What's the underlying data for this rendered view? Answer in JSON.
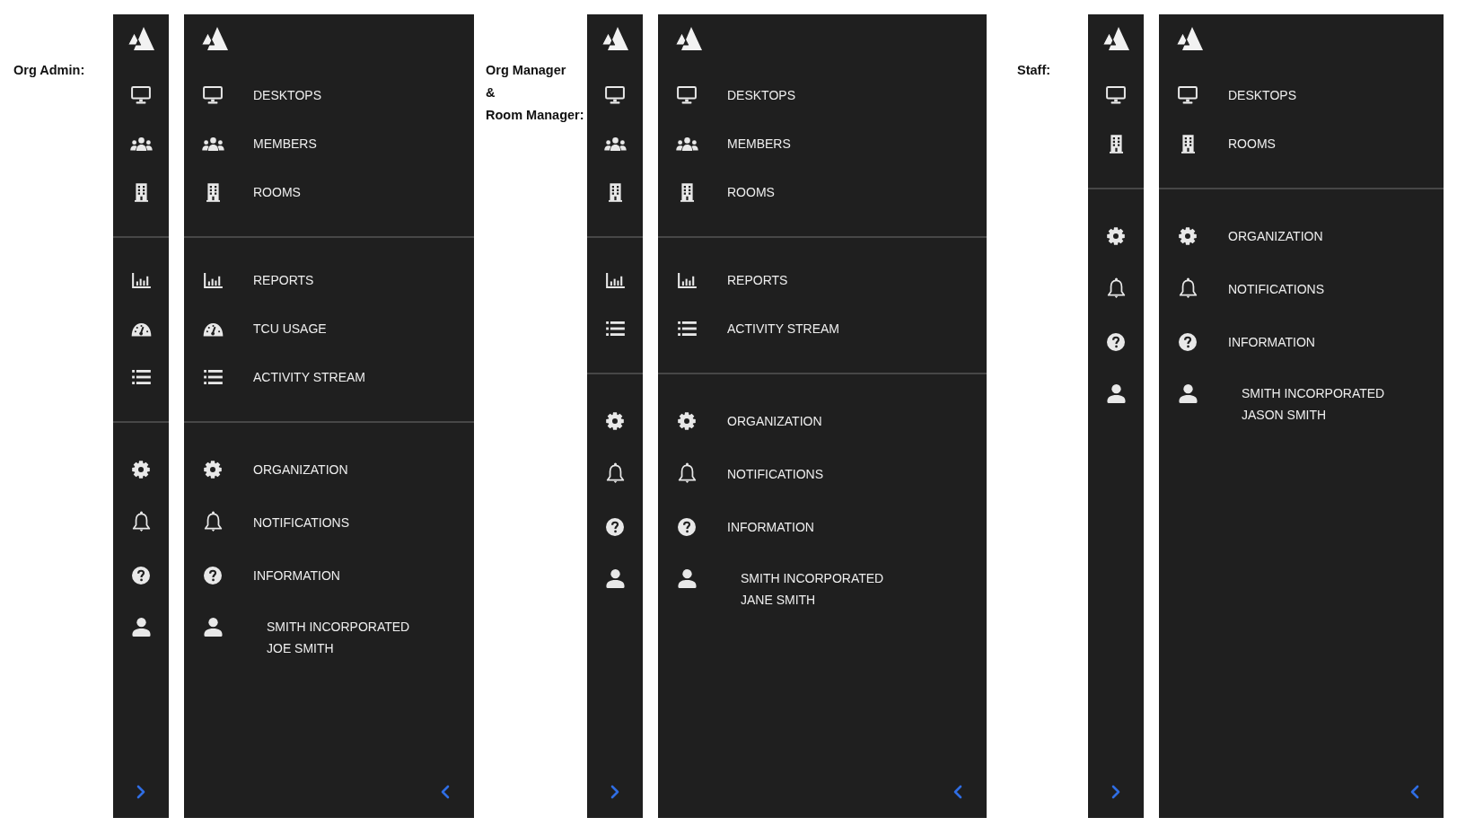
{
  "roles": [
    {
      "label_lines": [
        "Org Admin:"
      ],
      "sections": [
        {
          "items": [
            {
              "kind": "desktops",
              "label": "DESKTOPS"
            },
            {
              "kind": "members",
              "label": "MEMBERS"
            },
            {
              "kind": "rooms",
              "label": "ROOMS"
            }
          ]
        },
        {
          "items": [
            {
              "kind": "reports",
              "label": "REPORTS"
            },
            {
              "kind": "usage",
              "label": "TCU USAGE"
            },
            {
              "kind": "activity",
              "label": "ACTIVITY STREAM"
            }
          ]
        },
        {
          "items": [
            {
              "kind": "organization",
              "label": "ORGANIZATION"
            },
            {
              "kind": "notifications",
              "label": "NOTIFICATIONS"
            },
            {
              "kind": "information",
              "label": "INFORMATION"
            },
            {
              "kind": "account",
              "organization": "SMITH INCORPORATED",
              "user": "JOE SMITH"
            }
          ]
        }
      ]
    },
    {
      "label_lines": [
        "Org Manager",
        "&",
        "Room Manager:"
      ],
      "sections": [
        {
          "items": [
            {
              "kind": "desktops",
              "label": "DESKTOPS"
            },
            {
              "kind": "members",
              "label": "MEMBERS"
            },
            {
              "kind": "rooms",
              "label": "ROOMS"
            }
          ]
        },
        {
          "items": [
            {
              "kind": "reports",
              "label": "REPORTS"
            },
            {
              "kind": "activity",
              "label": "ACTIVITY STREAM"
            }
          ]
        },
        {
          "items": [
            {
              "kind": "organization",
              "label": "ORGANIZATION"
            },
            {
              "kind": "notifications",
              "label": "NOTIFICATIONS"
            },
            {
              "kind": "information",
              "label": "INFORMATION"
            },
            {
              "kind": "account",
              "organization": "SMITH INCORPORATED",
              "user": "JANE SMITH"
            }
          ]
        }
      ]
    },
    {
      "label_lines": [
        "Staff:"
      ],
      "sections": [
        {
          "items": [
            {
              "kind": "desktops",
              "label": "DESKTOPS"
            },
            {
              "kind": "rooms",
              "label": "ROOMS"
            }
          ]
        },
        {
          "items": [
            {
              "kind": "organization",
              "label": "ORGANIZATION"
            },
            {
              "kind": "notifications",
              "label": "NOTIFICATIONS"
            },
            {
              "kind": "information",
              "label": "INFORMATION"
            },
            {
              "kind": "account",
              "organization": "SMITH INCORPORATED",
              "user": "JASON SMITH"
            }
          ]
        }
      ]
    }
  ]
}
